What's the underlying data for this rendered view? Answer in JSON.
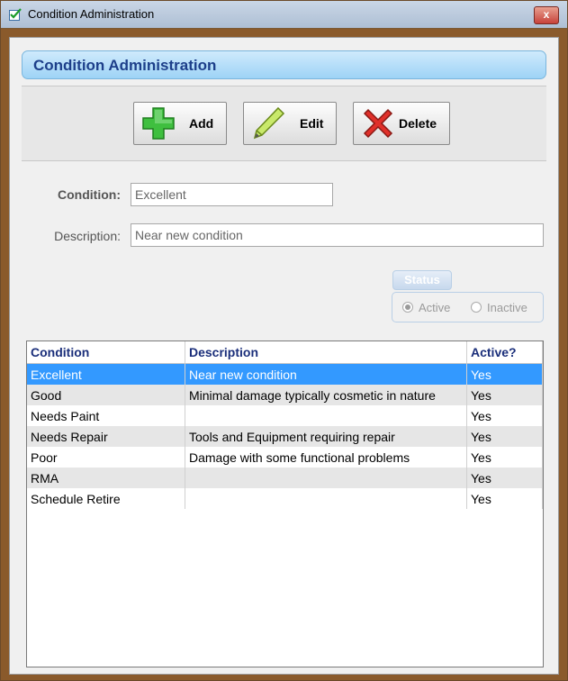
{
  "window": {
    "title": "Condition Administration",
    "close_glyph": "x"
  },
  "header": {
    "title": "Condition Administration"
  },
  "toolbar": {
    "add_label": "Add",
    "edit_label": "Edit",
    "delete_label": "Delete"
  },
  "form": {
    "condition_label": "Condition:",
    "condition_value": "Excellent",
    "description_label": "Description:",
    "description_value": "Near new condition"
  },
  "status": {
    "legend": "Status",
    "active_label": "Active",
    "inactive_label": "Inactive",
    "selected": "Active"
  },
  "table": {
    "columns": [
      "Condition",
      "Description",
      "Active?"
    ],
    "rows": [
      [
        "Excellent",
        "Near new condition",
        "Yes"
      ],
      [
        "Good",
        "Minimal damage typically cosmetic in nature",
        "Yes"
      ],
      [
        "Needs Paint",
        "",
        "Yes"
      ],
      [
        "Needs Repair",
        "Tools and Equipment requiring repair",
        "Yes"
      ],
      [
        "Poor",
        "Damage with some functional problems",
        "Yes"
      ],
      [
        "RMA",
        "",
        "Yes"
      ],
      [
        "Schedule Retire",
        "",
        "Yes"
      ]
    ],
    "selected_row": 0
  },
  "colors": {
    "header_text": "#1d3f8a",
    "selection": "#3399ff",
    "column_header_text": "#1a2e7a"
  }
}
